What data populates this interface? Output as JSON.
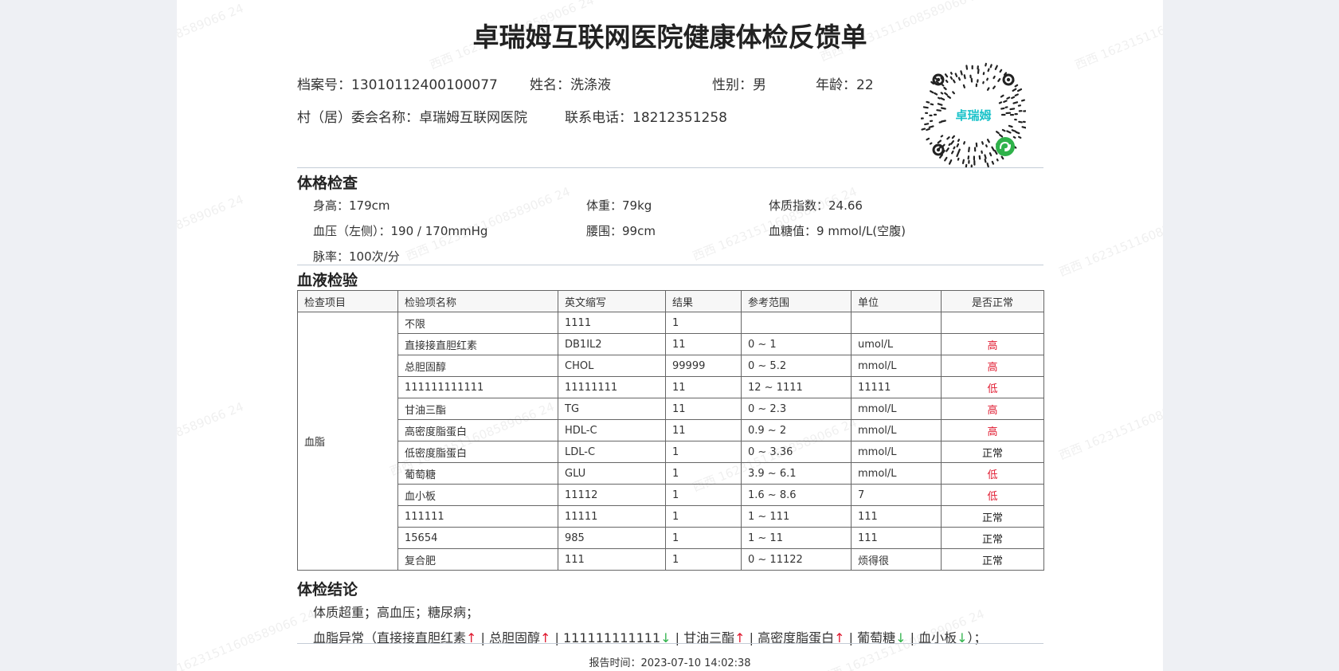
{
  "title": "卓瑞姆互联网医院健康体检反馈单",
  "watermark": "西西 16231511608589066 24",
  "patient": {
    "file_label": "档案号：",
    "file_no": "13010112400100077",
    "name_label": "姓名：",
    "name": "洗涤液",
    "gender_label": "性别：",
    "gender": "男",
    "age_label": "年龄：",
    "age": "22",
    "committee_label": "村（居）委会名称：",
    "committee": "卓瑞姆互联网医院",
    "phone_label": "联系电话：",
    "phone": "18212351258"
  },
  "qr": {
    "brand": "卓瑞姆",
    "icon": "mini-program-qr-code"
  },
  "physical": {
    "title": "体格检查",
    "height_label": "身高：",
    "height": "179cm",
    "weight_label": "体重：",
    "weight": "79kg",
    "bmi_label": "体质指数：",
    "bmi": "24.66",
    "bp_label": "血压（左侧）：",
    "bp": "190 / 170mmHg",
    "waist_label": "腰围：",
    "waist": "99cm",
    "glucose_label": "血糖值：",
    "glucose": "9 mmol/L(空腹)",
    "pulse_label": "脉率：",
    "pulse": "100次/分"
  },
  "blood": {
    "title": "血液检验",
    "headers": [
      "检查项目",
      "检验项名称",
      "英文缩写",
      "结果",
      "参考范围",
      "单位",
      "是否正常"
    ],
    "category": "血脂",
    "rows": [
      {
        "name": "不限",
        "abbr": "1111",
        "result": "1",
        "range": "",
        "unit": "",
        "flag": "",
        "status": "normal"
      },
      {
        "name": "直接接直胆红素",
        "abbr": "DB1IL2",
        "result": "11",
        "range": "0 ~ 1",
        "unit": "umol/L",
        "flag": "高",
        "status": "high"
      },
      {
        "name": "总胆固醇",
        "abbr": "CHOL",
        "result": "99999",
        "range": "0 ~ 5.2",
        "unit": "mmol/L",
        "flag": "高",
        "status": "high"
      },
      {
        "name": "111111111111",
        "abbr": "11111111",
        "result": "11",
        "range": "12 ~ 1111",
        "unit": "11111",
        "flag": "低",
        "status": "low"
      },
      {
        "name": "甘油三酯",
        "abbr": "TG",
        "result": "11",
        "range": "0 ~ 2.3",
        "unit": "mmol/L",
        "flag": "高",
        "status": "high"
      },
      {
        "name": "高密度脂蛋白",
        "abbr": "HDL-C",
        "result": "11",
        "range": "0.9 ~ 2",
        "unit": "mmol/L",
        "flag": "高",
        "status": "high"
      },
      {
        "name": "低密度脂蛋白",
        "abbr": "LDL-C",
        "result": "1",
        "range": "0 ~ 3.36",
        "unit": "mmol/L",
        "flag": "正常",
        "status": "normal"
      },
      {
        "name": "葡萄糖",
        "abbr": "GLU",
        "result": "1",
        "range": "3.9 ~ 6.1",
        "unit": "mmol/L",
        "flag": "低",
        "status": "low"
      },
      {
        "name": "血小板",
        "abbr": "11112",
        "result": "1",
        "range": "1.6 ~ 8.6",
        "unit": "7",
        "flag": "低",
        "status": "low"
      },
      {
        "name": "111111",
        "abbr": "11111",
        "result": "1",
        "range": "1 ~ 111",
        "unit": "111",
        "flag": "正常",
        "status": "normal"
      },
      {
        "name": "15654",
        "abbr": "985",
        "result": "1",
        "range": "1 ~ 11",
        "unit": "111",
        "flag": "正常",
        "status": "normal"
      },
      {
        "name": "复合肥",
        "abbr": "111",
        "result": "1",
        "range": "0 ~ 11122",
        "unit": "烦得很",
        "flag": "正常",
        "status": "normal"
      }
    ]
  },
  "conclusion": {
    "title": "体检结论",
    "line1": "体质超重；高血压；糖尿病；",
    "lipid_prefix": "血脂异常（",
    "lipid_items": [
      {
        "name": "直接接直胆红素",
        "arrow": "↑",
        "dir": "up"
      },
      {
        "name": "总胆固醇",
        "arrow": "↑",
        "dir": "up"
      },
      {
        "name": "111111111111",
        "arrow": "↓",
        "dir": "down"
      },
      {
        "name": "甘油三酯",
        "arrow": "↑",
        "dir": "up"
      },
      {
        "name": "高密度脂蛋白",
        "arrow": "↑",
        "dir": "up"
      },
      {
        "name": "葡萄糖",
        "arrow": "↓",
        "dir": "down"
      },
      {
        "name": "血小板",
        "arrow": "↓",
        "dir": "down"
      }
    ],
    "separator": " | ",
    "lipid_suffix": "）；"
  },
  "report": {
    "label": "报告时间：",
    "time": "2023-07-10 14:02:38"
  },
  "colors": {
    "high": "#e0192f",
    "low": "#e0192f",
    "up": "#e0192f",
    "down": "#2fb24a",
    "qr_brand": "#19c2c9",
    "qr_badge": "#2fb24a"
  }
}
